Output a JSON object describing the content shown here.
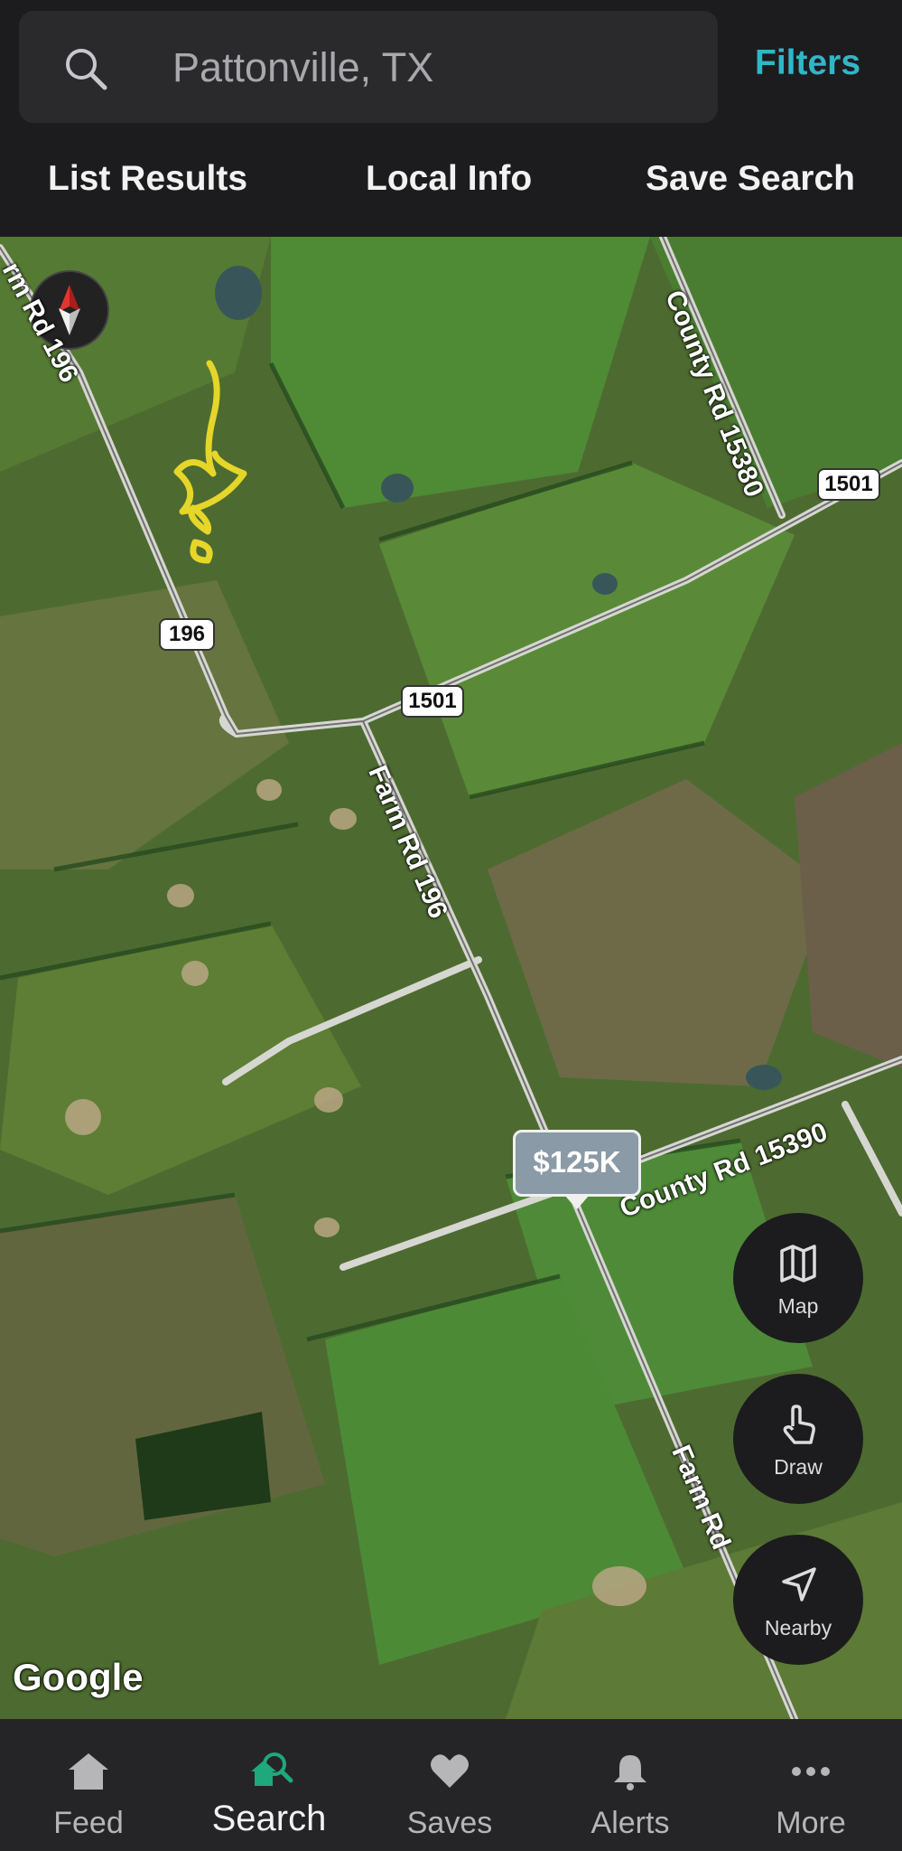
{
  "search": {
    "value": "Pattonville, TX",
    "filters_label": "Filters"
  },
  "actions": {
    "list_results": "List Results",
    "local_info": "Local Info",
    "save_search": "Save Search"
  },
  "map": {
    "listing_price": "$125K",
    "attribution": "Google",
    "road_labels": {
      "farm_rd_196_top": "rm Rd 196",
      "county_rd_15380": "County Rd 15380",
      "farm_rd_196_mid": "Farm Rd 196",
      "county_rd_15390": "County Rd 15390",
      "farm_rd_bottom": "Farm Rd"
    },
    "shields": {
      "s1501_a": "1501",
      "s1501_b": "1501",
      "s196": "196"
    }
  },
  "map_controls": {
    "map": "Map",
    "draw": "Draw",
    "nearby": "Nearby"
  },
  "bottom_nav": [
    {
      "label": "Feed",
      "icon": "home-icon"
    },
    {
      "label": "Search",
      "icon": "search-home-icon"
    },
    {
      "label": "Saves",
      "icon": "heart-icon"
    },
    {
      "label": "Alerts",
      "icon": "bell-icon"
    },
    {
      "label": "More",
      "icon": "more-dots-icon"
    }
  ],
  "colors": {
    "accent": "#31b6c8",
    "active_nav": "#1fa87a"
  }
}
